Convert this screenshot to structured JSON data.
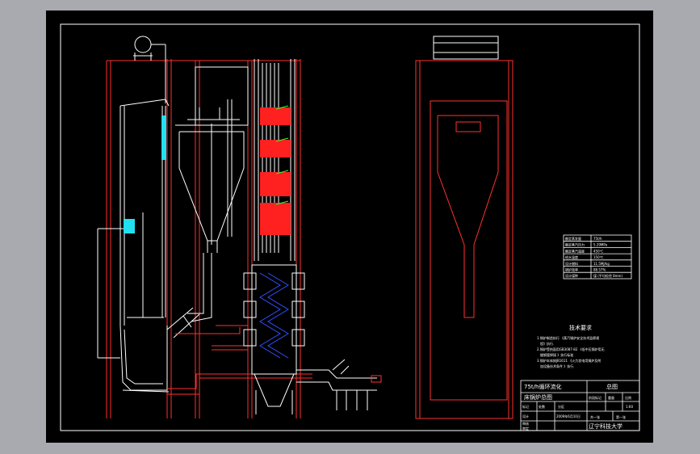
{
  "drawing": {
    "technical_requirements": {
      "heading": "技术要求",
      "lines": [
        "1.锅炉制造执行 《蒸汽锅炉安全技术监察规",
        "程》执行.",
        "2.锅炉受热面用GB3087-82 《低中压锅炉用无",
        "缝钢管焊接 》执行标准",
        "3.锅炉本体按JB1611 《火力发电用锅炉及附",
        "加设备技术条件 》执行."
      ]
    },
    "spec_table": {
      "rows": [
        [
          "额定蒸发量",
          "75t/h"
        ],
        [
          "额定蒸汽压力",
          "5.29MPa"
        ],
        [
          "额定蒸汽温度",
          "450℃"
        ],
        [
          "给水温度",
          "150℃"
        ],
        [
          "设计燃料",
          "11.5MJ/kg"
        ],
        [
          "锅炉效率",
          "88.57%"
        ],
        [
          "设计煤种",
          "煤 (平均粒径 8mm)"
        ]
      ]
    },
    "title_block": {
      "title_line1": "75t/h循环流化",
      "title_line2": "床锅炉总图",
      "mark": "总图",
      "stage_header": [
        "阶段标记",
        "重量",
        "比例"
      ],
      "scale": "1:60",
      "sheet_info": [
        "共一张",
        "第一张"
      ],
      "school": "辽宁科技大学",
      "rows": [
        [
          "标记",
          "处数",
          "分区"
        ],
        [
          "设计",
          "",
          "2009年6月10日"
        ],
        [
          "审核",
          "",
          ""
        ],
        [
          "审定",
          "",
          ""
        ]
      ]
    }
  }
}
